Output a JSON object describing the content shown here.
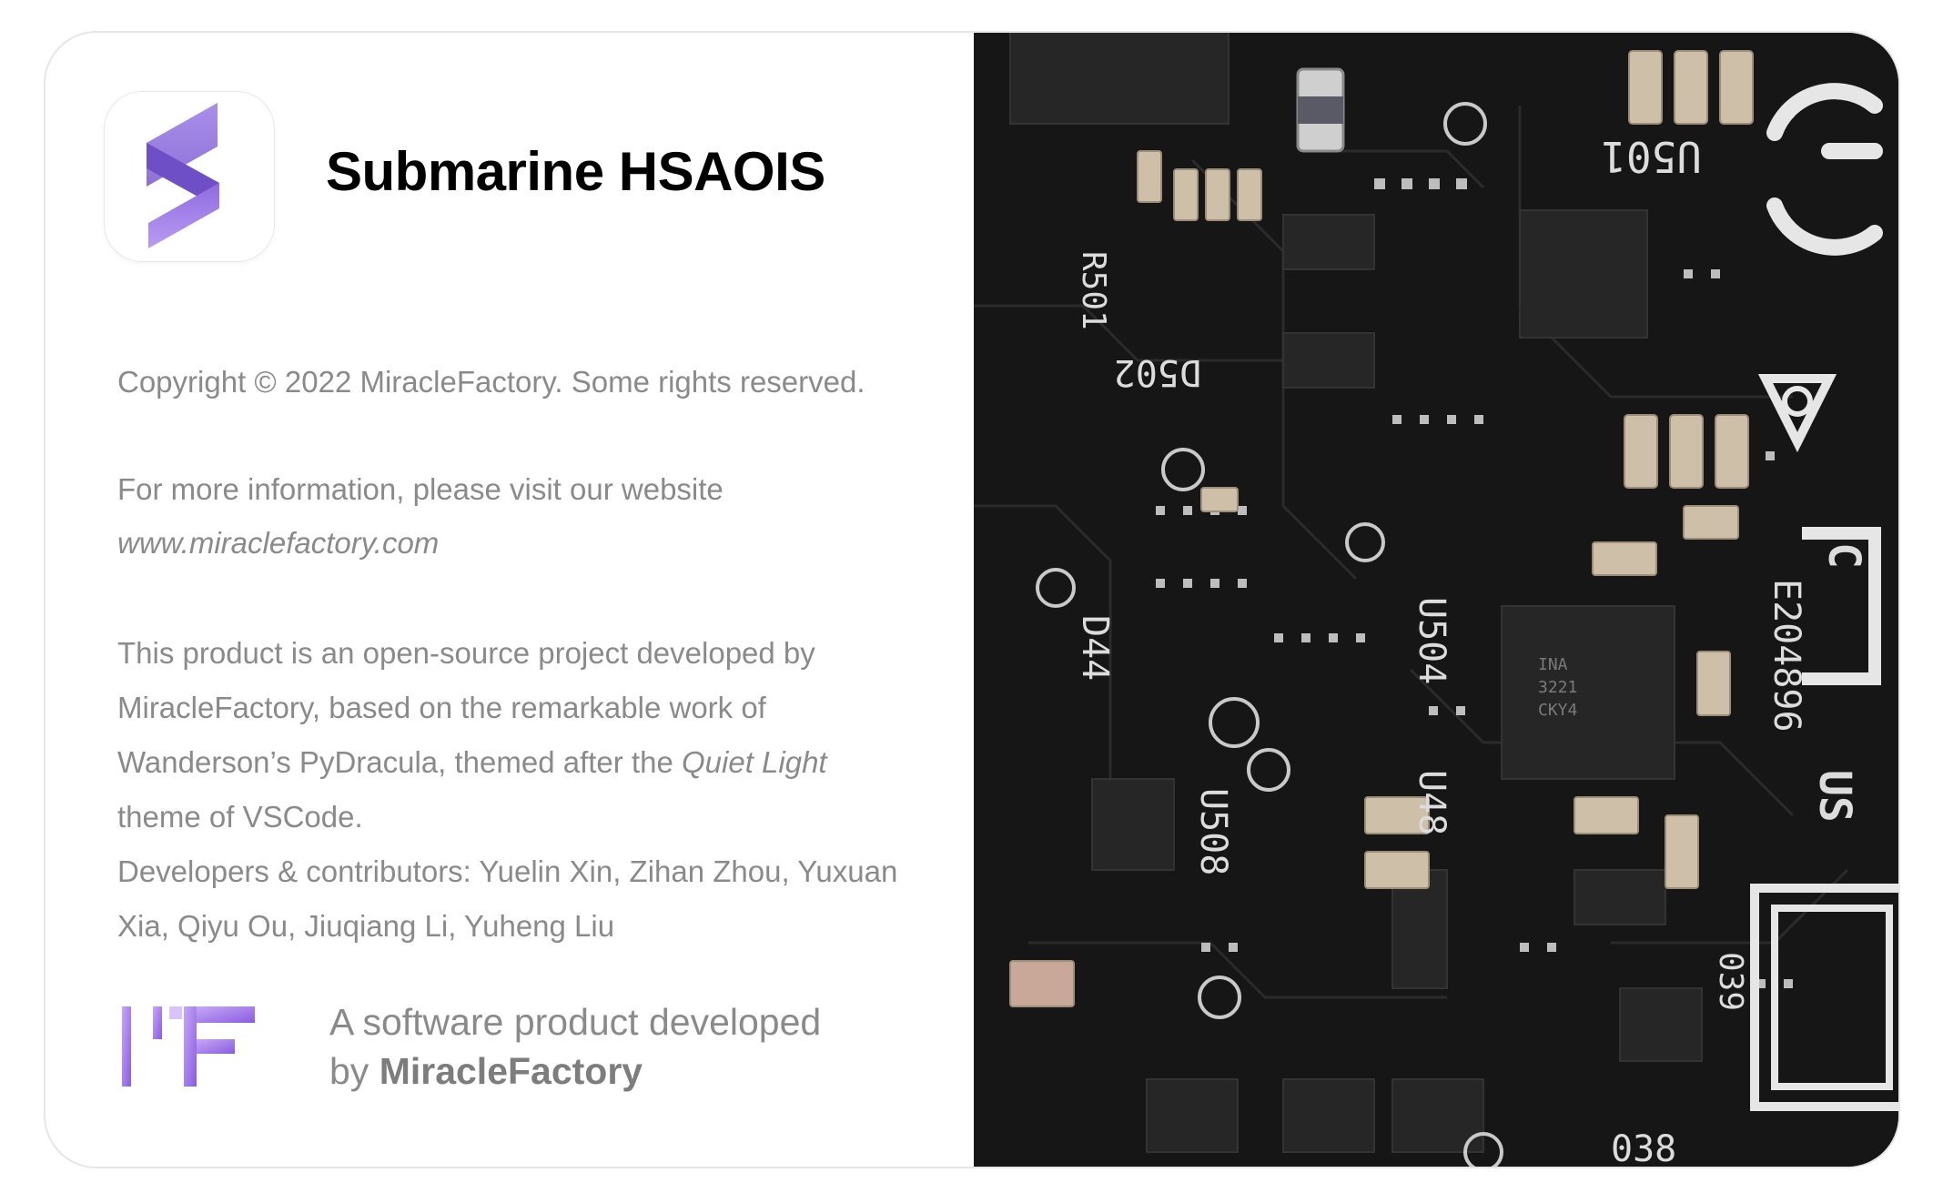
{
  "app": {
    "title": "Submarine HSAOIS"
  },
  "about": {
    "copyright": "Copyright © 2022 MiracleFactory. Some rights reserved.",
    "info_line": "For more information, please visit our website",
    "website": "www.miraclefactory.com",
    "description_line1": "This product is an open-source project developed by",
    "description_line2": "MiracleFactory, based on the remarkable work of",
    "description_line3_prefix": "Wanderson’s PyDracula, themed after the ",
    "description_line3_theme": "Quiet Light",
    "description_line4": "theme of VSCode.",
    "contributors_line1": "Developers & contributors: Yuelin Xin, Zihan Zhou, Yuxuan",
    "contributors_line2": "Xia, Qiyu Ou, Jiuqiang Li, Yuheng Liu"
  },
  "footer": {
    "tagline_line1": "A software product developed",
    "tagline_by": "by ",
    "company": "MiracleFactory"
  },
  "photo": {
    "labels": [
      "U501",
      "R501",
      "D502",
      "U504",
      "D44",
      "U508",
      "U48",
      "E204896",
      "US",
      "C",
      "039",
      "038",
      "INA",
      "3221",
      "CKY4"
    ]
  },
  "colors": {
    "accent_purple": "#8a6ad8",
    "logo_purple_light": "#b89cf0",
    "text_gray": "#8a8a8a",
    "photo_bg": "#151515"
  },
  "icons": {
    "app_icon": "stacked-chevron-logo-icon",
    "company_logo": "mf-logo-icon"
  }
}
